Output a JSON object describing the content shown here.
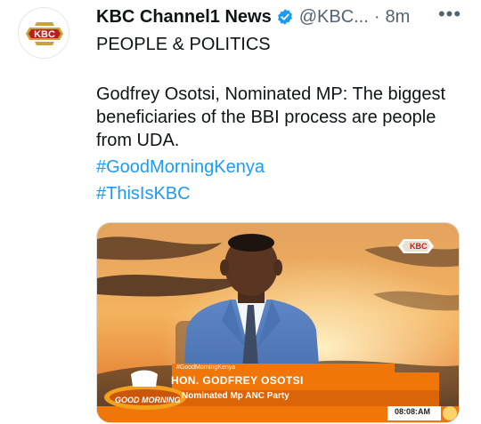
{
  "tweet": {
    "author": {
      "display_name": "KBC Channel1 News",
      "handle": "@KBC...",
      "verified": true,
      "avatar_text": "KBC"
    },
    "separator": "·",
    "time": "8m",
    "more_label": "•••",
    "category": "PEOPLE & POLITICS",
    "body": "Godfrey Osotsi, Nominated MP: The biggest beneficiaries of the BBI process are people from UDA.",
    "hashtags": [
      "#GoodMorningKenya",
      "#ThisIsKBC"
    ]
  },
  "media": {
    "channel_bug": "KBC",
    "lower_third": {
      "hashtag": "#GoodMorningKenya",
      "name": "HON. GODFREY OSOTSI",
      "role": "Nominated Mp ANC Party"
    },
    "show_logo": "GOOD MORNING",
    "clock": "08:08:AM"
  },
  "colors": {
    "link": "#1d9bf0",
    "secondary_text": "#536471",
    "kbc_red": "#c91b1b",
    "lower_third_orange": "#f0760a"
  }
}
